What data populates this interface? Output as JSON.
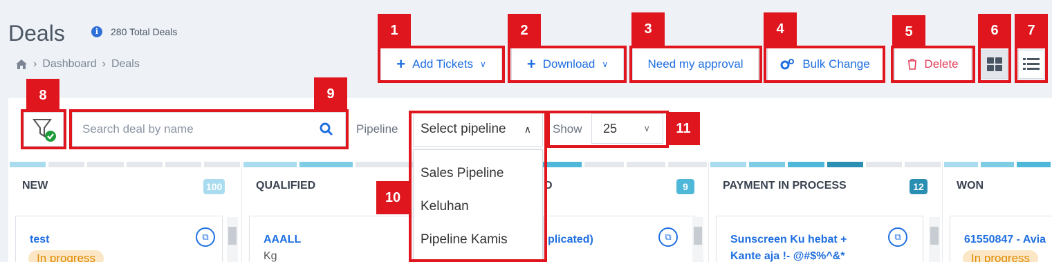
{
  "header": {
    "title": "Deals",
    "total": "280 Total Deals"
  },
  "breadcrumb": {
    "items": [
      "Dashboard",
      "Deals"
    ]
  },
  "toolbar": {
    "add_tickets": "Add Tickets",
    "download": "Download",
    "need_approval": "Need my approval",
    "bulk_change": "Bulk Change",
    "delete": "Delete"
  },
  "markers": [
    "1",
    "2",
    "3",
    "4",
    "5",
    "6",
    "7",
    "8",
    "9",
    "10",
    "11"
  ],
  "search": {
    "placeholder": "Search deal by name"
  },
  "pipeline": {
    "label": "Pipeline",
    "value": "Select pipeline",
    "options": [
      "Sales Pipeline",
      "Keluhan",
      "Pipeline Kamis"
    ]
  },
  "show": {
    "label": "Show",
    "value": "25"
  },
  "columns": [
    {
      "name": "NEW",
      "count": "100",
      "count_color": "#a9dcee"
    },
    {
      "name": "QUALIFIED"
    },
    {
      "name": "D",
      "count": "9",
      "count_color": "#4fb7d8"
    },
    {
      "name": "PAYMENT IN PROCESS",
      "count": "12",
      "count_color": "#2a8fb3"
    },
    {
      "name": "WON"
    }
  ],
  "cards": [
    {
      "title": "test",
      "status": "In progress"
    },
    {
      "title": "AAALL",
      "sub": "Kg"
    },
    {
      "title": "plicated)"
    },
    {
      "title": "Sunscreen Ku hebat +",
      "sub": "Kante aja !-  @#$%^&*"
    },
    {
      "title": "61550847 - Avia",
      "status": "In progress"
    }
  ],
  "colors": {
    "accent": "#1f6fe0",
    "marker": "#e0161e",
    "delete": "#e0405a"
  }
}
